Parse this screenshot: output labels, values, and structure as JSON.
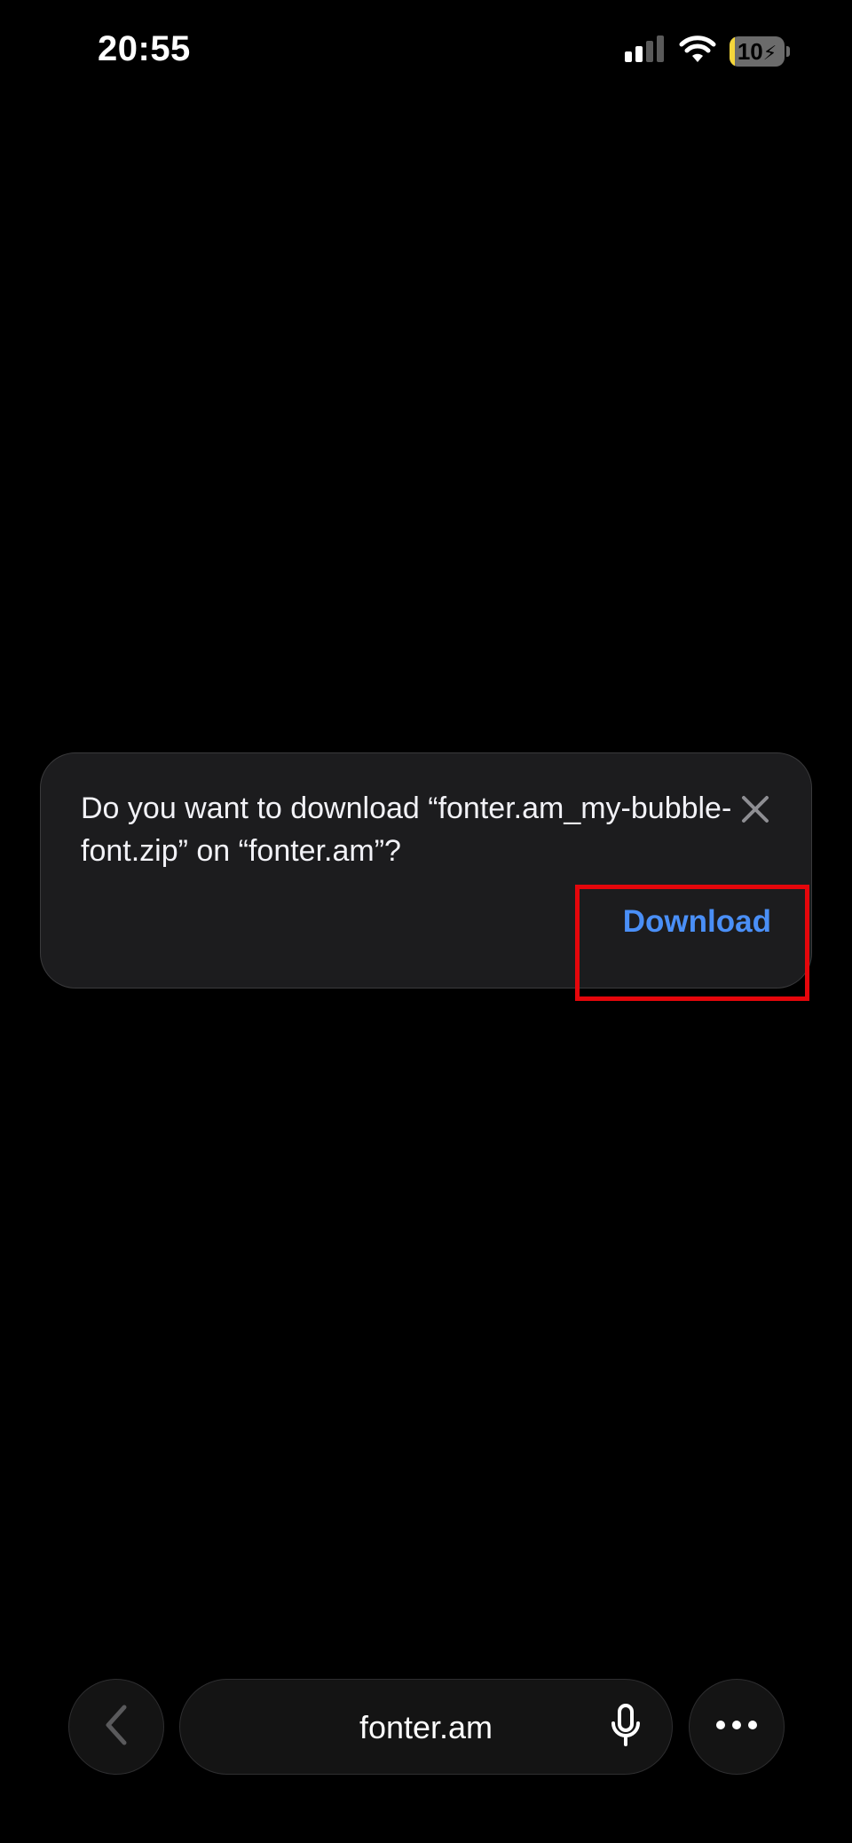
{
  "status_bar": {
    "time": "20:55",
    "signal_icon": "cellular-signal-icon",
    "wifi_icon": "wifi-icon",
    "battery_level": "10",
    "battery_fraction": 0.1,
    "battery_charging": true,
    "battery_fill_color": "#f4d63b"
  },
  "dialog": {
    "message": "Do you want to download “fonter.am_my-bubble-font.zip” on “fonter.am”?",
    "close_icon": "close-icon",
    "download_label": "Download",
    "download_color": "#4a8ff7",
    "highlight_color": "#e5060b"
  },
  "toolbar": {
    "back_icon": "chevron-left-icon",
    "address": "fonter.am",
    "mic_icon": "microphone-icon",
    "more_icon": "more-dots-icon"
  }
}
